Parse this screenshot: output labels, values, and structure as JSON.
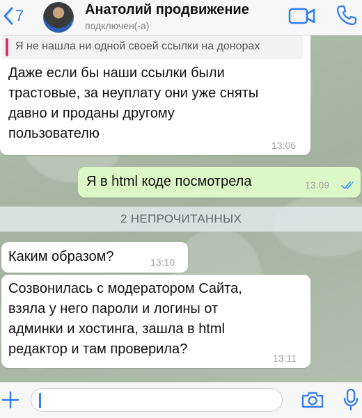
{
  "header": {
    "back_count": "7",
    "contact_name": "Анатолий продвижение",
    "status": "подключен(-а)"
  },
  "messages": [
    {
      "direction": "in",
      "quote": "Я не нашла ни одной своей ссылки на донорах",
      "lines": [
        "Даже если бы наши ссылки были",
        "трастовые, за неуплату они уже сняты",
        "давно и проданы другому",
        "пользователю"
      ],
      "time": "13:06"
    },
    {
      "direction": "out",
      "lines": [
        "Я в html коде посмотрела"
      ],
      "time": "13:09",
      "status": "read"
    },
    {
      "direction": "in",
      "lines": [
        "Каким образом?"
      ],
      "time": "13:10"
    },
    {
      "direction": "in",
      "lines": [
        "Созвонилась с модератором Сайта,",
        "взяла у него пароли и логины от",
        "админки и хостинга, зашла в html",
        "редактор и там проверила?"
      ],
      "time": "13:11"
    }
  ],
  "unread_banner": "2 НЕПРОЧИТАННЫХ",
  "input": {
    "value": "",
    "placeholder": ""
  },
  "colors": {
    "accent": "#2f7cf6",
    "outgoing_bubble": "#dcf8c6",
    "incoming_bubble": "#ffffff",
    "quote_bar": "#d6336c",
    "read_ticks": "#4fa3f7"
  },
  "icons": [
    "chevron-left-icon",
    "video-call-icon",
    "phone-icon",
    "plus-icon",
    "camera-icon",
    "microphone-icon",
    "double-check-icon"
  ]
}
